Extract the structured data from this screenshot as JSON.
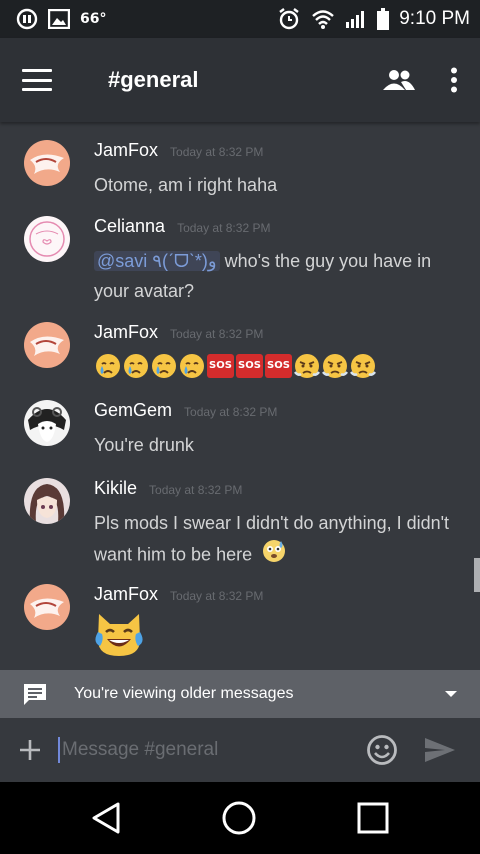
{
  "status_bar": {
    "notification_count": "66°",
    "time": "9:10 PM",
    "icons": [
      "app-notification-icon",
      "image-icon",
      "alarm-icon",
      "wifi-icon",
      "signal-icon",
      "battery-icon"
    ]
  },
  "app_bar": {
    "channel_name": "#general",
    "icons": [
      "menu-icon",
      "members-icon",
      "more-icon"
    ]
  },
  "messages": [
    {
      "author": "JamFox",
      "timestamp": "Today at 8:32 PM",
      "text": "Otome, am i right haha"
    },
    {
      "author": "Celianna",
      "timestamp": "Today at 8:32 PM",
      "mention": "@savi ٩(ˊᗜˋ*)و",
      "text": " who's the guy you have in your avatar?"
    },
    {
      "author": "JamFox",
      "timestamp": "Today at 8:32 PM",
      "emojis": [
        "crying-face",
        "crying-face",
        "crying-face",
        "crying-face",
        "sos",
        "sos",
        "sos",
        "triumph-face",
        "triumph-face",
        "triumph-face"
      ],
      "sos_label": "SOS"
    },
    {
      "author": "GemGem",
      "timestamp": "Today at 8:32 PM",
      "text": "You're drunk"
    },
    {
      "author": "Kikile",
      "timestamp": "Today at 8:32 PM",
      "text": "Pls mods I swear I didn't do anything, I didn't want him to be here"
    },
    {
      "author": "JamFox",
      "timestamp": "Today at 8:32 PM",
      "emojis": [
        "tears-of-joy-cat"
      ]
    }
  ],
  "older_banner": {
    "text": "You're viewing older messages"
  },
  "composer": {
    "placeholder": "Message #general"
  },
  "colors": {
    "background": "#36393e",
    "appbar": "#2e3136",
    "banner": "#5e6167",
    "mention": "#7c9cd8",
    "accent": "#7289da"
  }
}
